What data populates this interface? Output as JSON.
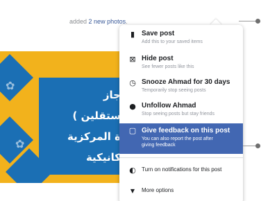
{
  "post": {
    "header_prefix": "added",
    "header_link": "2 new photos",
    "header_suffix": "."
  },
  "image": {
    "arabic_lines": [
      "جاز",
      "ستقلين )",
      "ة المركزية",
      "كانيكية"
    ]
  },
  "menu": {
    "items": [
      {
        "icon": "bookmark-icon",
        "title": "Save post",
        "subtitle": "Add this to your saved items"
      },
      {
        "icon": "hide-icon",
        "title": "Hide post",
        "subtitle": "See fewer posts like this"
      },
      {
        "icon": "clock-icon",
        "title": "Snooze Ahmad for 30 days",
        "subtitle": "Temporarily stop seeing posts"
      },
      {
        "icon": "unfollow-icon",
        "title": "Unfollow Ahmad",
        "subtitle": "Stop seeing posts but stay friends"
      },
      {
        "icon": "feedback-icon",
        "title": "Give feedback on this post",
        "subtitle": "You can also report the post after",
        "subtitle2": "giving feedback",
        "highlighted": true
      },
      {
        "icon": "notification-icon",
        "title": "Turn on notifications for this post"
      },
      {
        "icon": "caret-down-icon",
        "title": "More options"
      }
    ]
  },
  "colors": {
    "highlight": "#4267b2",
    "link": "#385898",
    "image_yellow": "#f2b21c",
    "image_blue": "#1b6fb4"
  }
}
